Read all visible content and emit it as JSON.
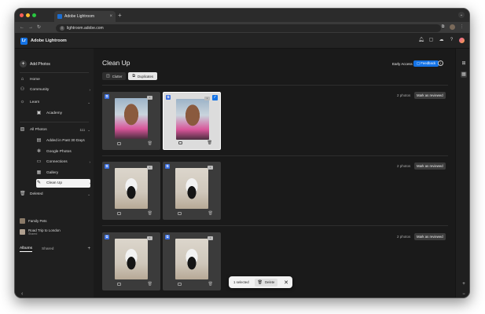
{
  "browser": {
    "tab_title": "Adobe Lightroom",
    "tab_close": "×",
    "new_tab": "+",
    "url": "lightroom.adobe.com",
    "traffic_lights": [
      "#ff5f57",
      "#febc2e",
      "#28c840"
    ]
  },
  "app": {
    "logo_text": "Lr",
    "name": "Adobe Lightroom",
    "accent": "#1473e6"
  },
  "sidebar": {
    "add_photos": "Add Photos",
    "home": "Home",
    "community": "Community",
    "learn": "Learn",
    "academy": "Academy",
    "all_photos": "All Photos",
    "all_photos_count": "111",
    "added_recent": "Added in Past 30 Days",
    "google_photos": "Google Photos",
    "connections": "Connections",
    "gallery": "Gallery",
    "clean_up": "Clean Up",
    "deleted": "Deleted",
    "albums_tab": "Albums",
    "shared_tab": "Shared",
    "albums": [
      {
        "name": "Family Pets",
        "sub": ""
      },
      {
        "name": "Road Trip to London",
        "sub": "Shared"
      }
    ]
  },
  "main": {
    "title": "Clean Up",
    "seg_clutter": "Clutter",
    "seg_duplicates": "Duplicates",
    "early_access": "Early Access",
    "feedback": "Feedback",
    "groups": [
      {
        "count": "2 photos",
        "review": "Mark as reviewed",
        "photo": "selfie"
      },
      {
        "count": "2 photos",
        "review": "Mark as reviewed",
        "photo": "cat"
      },
      {
        "count": "2 photos",
        "review": "Mark as reviewed",
        "photo": "cat"
      }
    ]
  },
  "selection_bar": {
    "selected": "1 selected",
    "delete": "Delete"
  }
}
